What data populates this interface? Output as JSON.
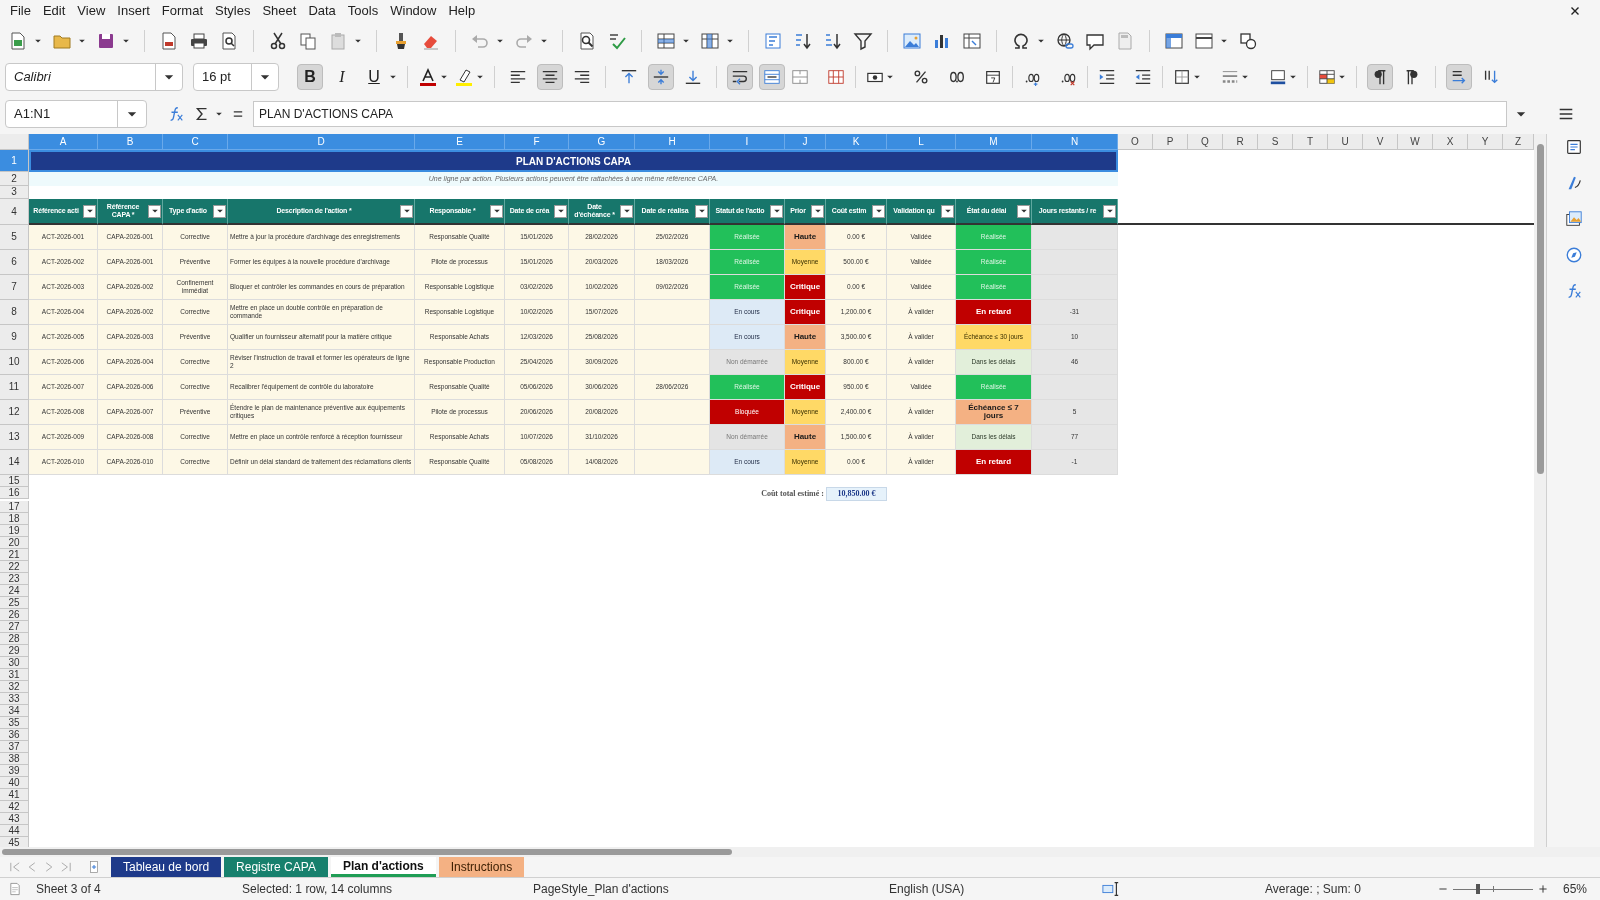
{
  "menu": [
    "File",
    "Edit",
    "View",
    "Insert",
    "Format",
    "Styles",
    "Sheet",
    "Data",
    "Tools",
    "Window",
    "Help"
  ],
  "format_toolbar": {
    "font_name": "Calibri",
    "font_size": "16 pt",
    "bold": {
      "label": "B",
      "pressed": true
    },
    "italic": {
      "label": "I",
      "pressed": false
    },
    "underline": {
      "label": "U",
      "pressed": false
    },
    "align_left": false,
    "align_center": true,
    "align_right": false,
    "align_top": false,
    "align_middle": true,
    "align_bottom": false,
    "wrap_text": true,
    "merge_center": true,
    "paragraph_ltr": true,
    "paragraph_rtl": false,
    "text_horizontal": true,
    "text_vertical": false
  },
  "formula_bar": {
    "name_box": "A1:N1",
    "formula": "PLAN D'ACTIONS CAPA"
  },
  "sheet": {
    "columns": [
      {
        "label": "A",
        "selected": true
      },
      {
        "label": "B",
        "selected": true
      },
      {
        "label": "C",
        "selected": true
      },
      {
        "label": "D",
        "selected": true
      },
      {
        "label": "E",
        "selected": true
      },
      {
        "label": "F",
        "selected": true
      },
      {
        "label": "G",
        "selected": true
      },
      {
        "label": "H",
        "selected": true
      },
      {
        "label": "I",
        "selected": true
      },
      {
        "label": "J",
        "selected": true
      },
      {
        "label": "K",
        "selected": true
      },
      {
        "label": "L",
        "selected": true
      },
      {
        "label": "M",
        "selected": true
      },
      {
        "label": "N",
        "selected": true
      },
      {
        "label": "O",
        "selected": false
      },
      {
        "label": "P",
        "selected": false
      },
      {
        "label": "Q",
        "selected": false
      },
      {
        "label": "R",
        "selected": false
      },
      {
        "label": "S",
        "selected": false
      },
      {
        "label": "T",
        "selected": false
      },
      {
        "label": "U",
        "selected": false
      },
      {
        "label": "V",
        "selected": false
      },
      {
        "label": "W",
        "selected": false
      },
      {
        "label": "X",
        "selected": false
      },
      {
        "label": "Y",
        "selected": false
      },
      {
        "label": "Z",
        "selected": false
      }
    ],
    "row_headers": [
      {
        "label": "1",
        "selected": true
      },
      {
        "label": "2",
        "selected": false
      },
      {
        "label": "3",
        "selected": false
      },
      {
        "label": "4",
        "selected": false
      },
      {
        "label": "5",
        "selected": false
      },
      {
        "label": "6",
        "selected": false
      },
      {
        "label": "7",
        "selected": false
      },
      {
        "label": "8",
        "selected": false
      },
      {
        "label": "9",
        "selected": false
      },
      {
        "label": "10",
        "selected": false
      },
      {
        "label": "11",
        "selected": false
      },
      {
        "label": "12",
        "selected": false
      },
      {
        "label": "13",
        "selected": false
      },
      {
        "label": "14",
        "selected": false
      },
      {
        "label": "15",
        "selected": false
      },
      {
        "label": "16",
        "selected": false
      },
      {
        "label": "17",
        "selected": false
      },
      {
        "label": "18",
        "selected": false
      },
      {
        "label": "19",
        "selected": false
      },
      {
        "label": "20",
        "selected": false
      },
      {
        "label": "21",
        "selected": false
      },
      {
        "label": "22",
        "selected": false
      },
      {
        "label": "23",
        "selected": false
      },
      {
        "label": "24",
        "selected": false
      },
      {
        "label": "25",
        "selected": false
      },
      {
        "label": "26",
        "selected": false
      },
      {
        "label": "27",
        "selected": false
      },
      {
        "label": "28",
        "selected": false
      },
      {
        "label": "29",
        "selected": false
      },
      {
        "label": "30",
        "selected": false
      },
      {
        "label": "31",
        "selected": false
      },
      {
        "label": "32",
        "selected": false
      },
      {
        "label": "33",
        "selected": false
      },
      {
        "label": "34",
        "selected": false
      },
      {
        "label": "35",
        "selected": false
      },
      {
        "label": "36",
        "selected": false
      },
      {
        "label": "37",
        "selected": false
      },
      {
        "label": "38",
        "selected": false
      },
      {
        "label": "39",
        "selected": false
      },
      {
        "label": "40",
        "selected": false
      },
      {
        "label": "41",
        "selected": false
      },
      {
        "label": "42",
        "selected": false
      },
      {
        "label": "43",
        "selected": false
      },
      {
        "label": "44",
        "selected": false
      },
      {
        "label": "45",
        "selected": false
      }
    ],
    "title": "PLAN D'ACTIONS CAPA",
    "subtitle": "Une ligne par action. Plusieurs actions peuvent être rattachées à une même référence CAPA.",
    "headers": [
      "Référence acti",
      "Référence CAPA *",
      "Type d'actio",
      "Description de l'action *",
      "Responsable *",
      "Date de créa",
      "Date d'échéance *",
      "Date de réalisa",
      "Statut de l'actio",
      "Prior",
      "Coût estim",
      "Validation qu",
      "État du délai",
      "Jours restants / re"
    ],
    "rows": [
      {
        "cells": [
          "ACT-2026-001",
          "CAPA-2026-001",
          "Corrective",
          "Mettre à jour la procédure d'archivage des enregistrements",
          "Responsable Qualité",
          "15/01/2026",
          "28/02/2026",
          "25/02/2026",
          {
            "text": "Réalisée",
            "color": "#22c05a",
            "bold": false
          },
          {
            "text": "Haute",
            "color": "#f4b183",
            "bold": true
          },
          "0.00 €",
          "Validée",
          {
            "text": "Réalisée",
            "color": "#22c05a",
            "bold": false
          },
          null
        ]
      },
      {
        "cells": [
          "ACT-2026-002",
          "CAPA-2026-001",
          "Préventive",
          "Former les équipes à la nouvelle procédure d'archivage",
          "Pilote de processus",
          "15/01/2026",
          "20/03/2026",
          "18/03/2026",
          {
            "text": "Réalisée",
            "color": "#22c05a",
            "bold": false
          },
          {
            "text": "Moyenne",
            "color": "#ffd966",
            "bold": false
          },
          "500.00 €",
          "Validée",
          {
            "text": "Réalisée",
            "color": "#22c05a",
            "bold": false
          },
          null
        ]
      },
      {
        "cells": [
          "ACT-2026-003",
          "CAPA-2026-002",
          "Confinement immédiat",
          "Bloquer et contrôler les commandes en cours de préparation",
          "Responsable Logistique",
          "03/02/2026",
          "10/02/2026",
          "09/02/2026",
          {
            "text": "Réalisée",
            "color": "#22c05a",
            "bold": false
          },
          {
            "text": "Critique",
            "color": "#c00000",
            "bold": true
          },
          "0.00 €",
          "Validée",
          {
            "text": "Réalisée",
            "color": "#22c05a",
            "bold": false
          },
          null
        ]
      },
      {
        "cells": [
          "ACT-2026-004",
          "CAPA-2026-002",
          "Corrective",
          "Mettre en place un double contrôle en préparation de commande",
          "Responsable Logistique",
          "10/02/2026",
          "15/07/2026",
          null,
          {
            "text": "En cours",
            "color": "#ddeaf6",
            "bold": false
          },
          {
            "text": "Critique",
            "color": "#c00000",
            "bold": true
          },
          "1,200.00 €",
          "À valider",
          {
            "text": "En retard",
            "color": "#c00000",
            "bold": true
          },
          "-31"
        ]
      },
      {
        "cells": [
          "ACT-2026-005",
          "CAPA-2026-003",
          "Préventive",
          "Qualifier un fournisseur alternatif pour la matière critique",
          "Responsable Achats",
          "12/03/2026",
          "25/08/2026",
          null,
          {
            "text": "En cours",
            "color": "#ddeaf6",
            "bold": false
          },
          {
            "text": "Haute",
            "color": "#f4b183",
            "bold": true
          },
          "3,500.00 €",
          "À valider",
          {
            "text": "Échéance ≤ 30 jours",
            "color": "#ffd966",
            "bold": false
          },
          "10"
        ]
      },
      {
        "cells": [
          "ACT-2026-006",
          "CAPA-2026-004",
          "Corrective",
          "Réviser l'instruction de travail et former les opérateurs de ligne 2",
          "Responsable Production",
          "25/04/2026",
          "30/09/2026",
          null,
          {
            "text": "Non démarrée",
            "color": "#e4e4e4",
            "bold": false
          },
          {
            "text": "Moyenne",
            "color": "#ffd966",
            "bold": false
          },
          "800.00 €",
          "À valider",
          {
            "text": "Dans les délais",
            "color": "#e2efda",
            "bold": false
          },
          "46"
        ]
      },
      {
        "cells": [
          "ACT-2026-007",
          "CAPA-2026-006",
          "Corrective",
          "Recalibrer l'équipement de contrôle du laboratoire",
          "Responsable Qualité",
          "05/06/2026",
          "30/06/2026",
          "28/06/2026",
          {
            "text": "Réalisée",
            "color": "#22c05a",
            "bold": false
          },
          {
            "text": "Critique",
            "color": "#c00000",
            "bold": true
          },
          "950.00 €",
          "Validée",
          {
            "text": "Réalisée",
            "color": "#22c05a",
            "bold": false
          },
          null
        ]
      },
      {
        "cells": [
          "ACT-2026-008",
          "CAPA-2026-007",
          "Préventive",
          "Étendre le plan de maintenance préventive aux équipements critiques",
          "Pilote de processus",
          "20/06/2026",
          "20/08/2026",
          null,
          {
            "text": "Bloquée",
            "color": "#c00000",
            "bold": false
          },
          {
            "text": "Moyenne",
            "color": "#ffd966",
            "bold": false
          },
          "2,400.00 €",
          "À valider",
          {
            "text": "Échéance ≤ 7 jours",
            "color": "#f4b183",
            "bold": true
          },
          "5"
        ]
      },
      {
        "cells": [
          "ACT-2026-009",
          "CAPA-2026-008",
          "Corrective",
          "Mettre en place un contrôle renforcé à réception fournisseur",
          "Responsable Achats",
          "10/07/2026",
          "31/10/2026",
          null,
          {
            "text": "Non démarrée",
            "color": "#e4e4e4",
            "bold": false
          },
          {
            "text": "Haute",
            "color": "#f4b183",
            "bold": true
          },
          "1,500.00 €",
          "À valider",
          {
            "text": "Dans les délais",
            "color": "#e2efda",
            "bold": false
          },
          "77"
        ]
      },
      {
        "cells": [
          "ACT-2026-010",
          "CAPA-2026-010",
          "Corrective",
          "Définir un délai standard de traitement des réclamations clients",
          "Responsable Qualité",
          "05/08/2026",
          "14/08/2026",
          null,
          {
            "text": "En cours",
            "color": "#ddeaf6",
            "bold": false
          },
          {
            "text": "Moyenne",
            "color": "#ffd966",
            "bold": false
          },
          "0.00 €",
          "À valider",
          {
            "text": "En retard",
            "color": "#c00000",
            "bold": true
          },
          "-1"
        ]
      }
    ],
    "total": {
      "label": "Coût total estimé :",
      "value": "10,850.00 €"
    }
  },
  "sheet_tabs": [
    {
      "label": "Tableau de bord",
      "color": "#1e3a8a",
      "selected": false
    },
    {
      "label": "Registre CAPA",
      "color": "#17806d",
      "selected": false
    },
    {
      "label": "Plan d'actions",
      "color": "#1f9d55",
      "selected": true
    },
    {
      "label": "Instructions",
      "color": "#f4b183",
      "selected": false
    }
  ],
  "status_bar": {
    "sheet": "Sheet 3 of 4",
    "selection": "Selected: 1 row, 14 columns",
    "page_style": "PageStyle_Plan d'actions",
    "language": "English (USA)",
    "sum": "Average: ; Sum: 0",
    "zoom": "65%",
    "zoom_level": {
      "level": 0.3
    }
  }
}
